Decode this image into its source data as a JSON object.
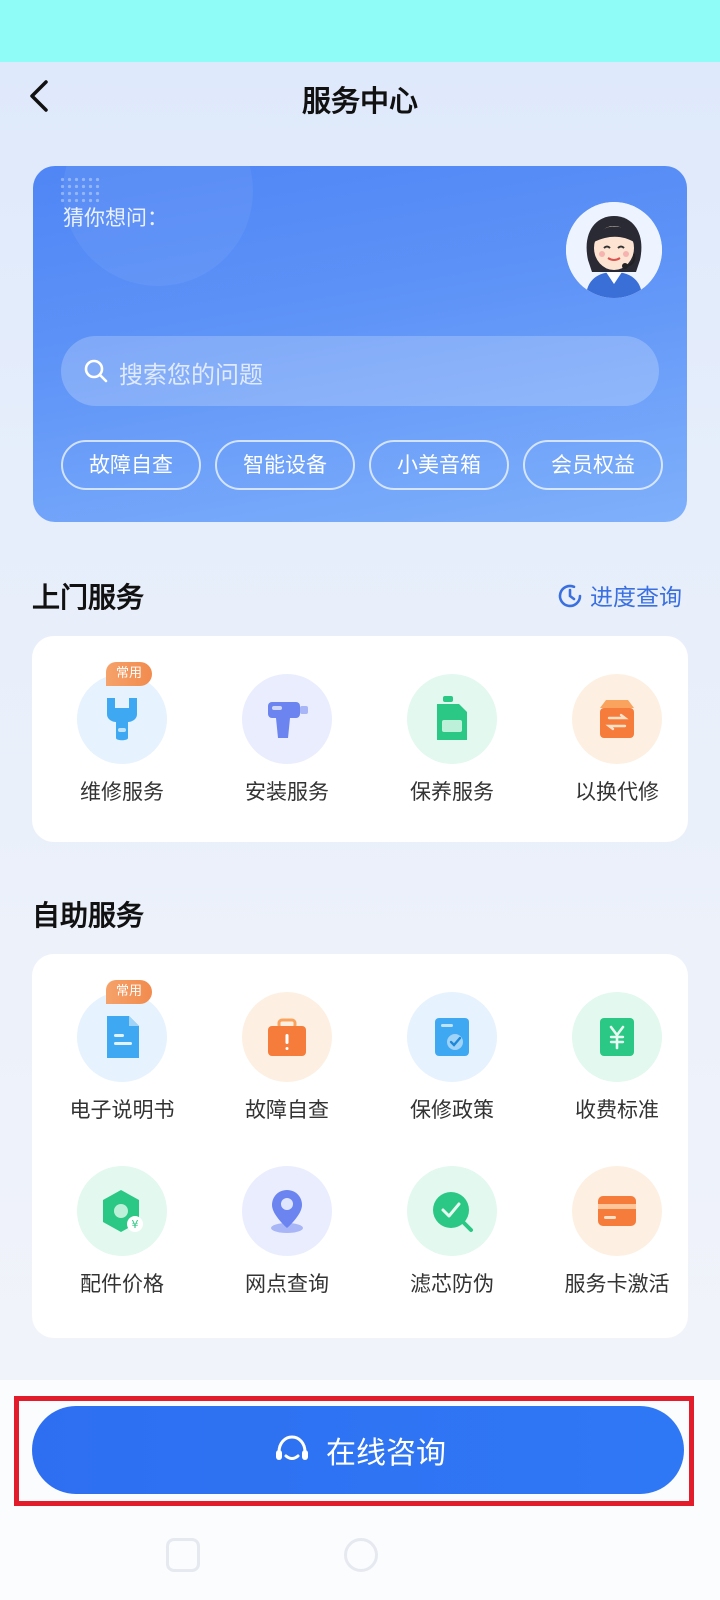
{
  "header": {
    "title": "服务中心"
  },
  "hero": {
    "guess_label": "猜你想问：",
    "search": {
      "placeholder": "搜索您的问题"
    },
    "chips": [
      "故障自查",
      "智能设备",
      "小美音箱",
      "会员权益"
    ]
  },
  "onsite": {
    "title": "上门服务",
    "progress_link": "进度查询",
    "items": [
      {
        "label": "维修服务",
        "icon": "wrench-icon",
        "badge": "常用"
      },
      {
        "label": "安装服务",
        "icon": "drill-icon"
      },
      {
        "label": "保养服务",
        "icon": "bottle-icon"
      },
      {
        "label": "以换代修",
        "icon": "swap-box-icon"
      }
    ]
  },
  "self_service": {
    "title": "自助服务",
    "items": [
      {
        "label": "电子说明书",
        "icon": "document-icon",
        "badge": "常用"
      },
      {
        "label": "故障自查",
        "icon": "toolbox-icon"
      },
      {
        "label": "保修政策",
        "icon": "policy-icon"
      },
      {
        "label": "收费标准",
        "icon": "yuan-icon"
      },
      {
        "label": "配件价格",
        "icon": "hex-price-icon"
      },
      {
        "label": "网点查询",
        "icon": "location-icon"
      },
      {
        "label": "滤芯防伪",
        "icon": "check-icon"
      },
      {
        "label": "服务卡激活",
        "icon": "card-icon"
      }
    ]
  },
  "footer": {
    "consult_label": "在线咨询"
  },
  "colors": {
    "primary": "#2e6ff1",
    "highlight": "#e31c2c",
    "badge": "#f28b4e"
  }
}
